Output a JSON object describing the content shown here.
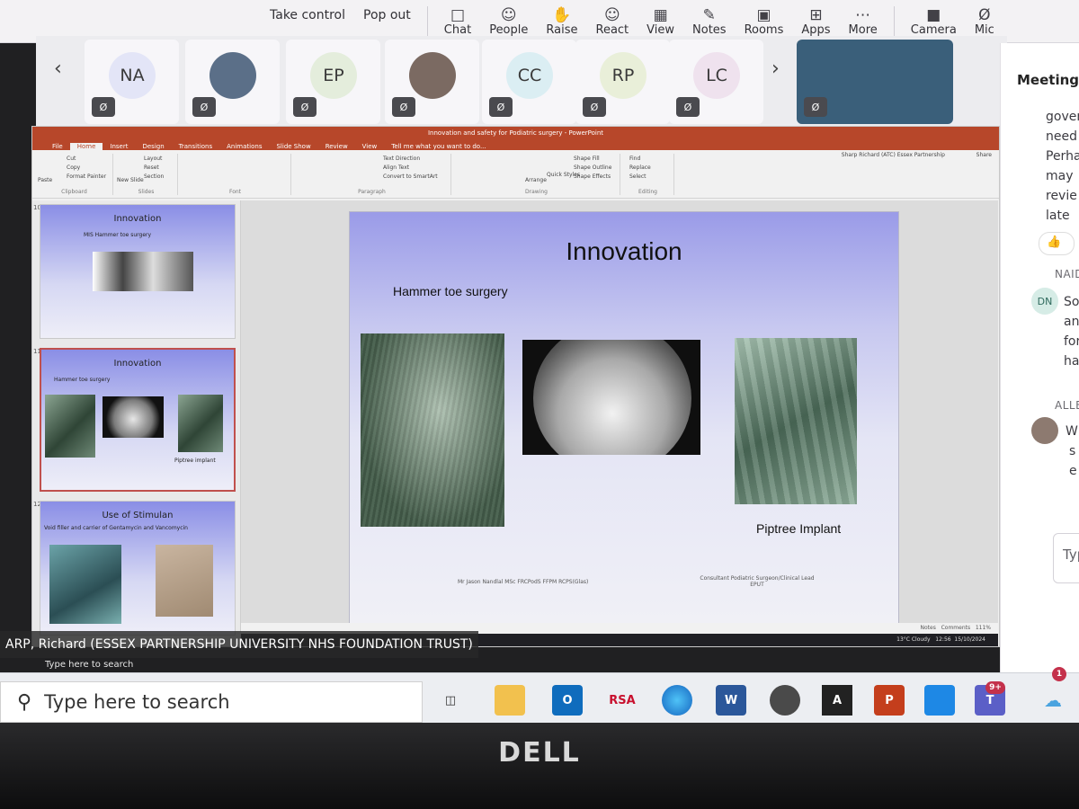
{
  "toolbar": {
    "take_control": "Take control",
    "pop_out": "Pop out",
    "chat": "Chat",
    "people": "People",
    "raise": "Raise",
    "react": "React",
    "view": "View",
    "notes": "Notes",
    "rooms": "Rooms",
    "apps": "Apps",
    "more": "More",
    "camera": "Camera",
    "mic": "Mic",
    "accent": "#5b5fc7"
  },
  "participants": [
    {
      "initials": "NA",
      "color": "#e3e5f7"
    },
    {
      "initials": "",
      "color": "#5b6f88"
    },
    {
      "initials": "EP",
      "color": "#e4eddc"
    },
    {
      "initials": "",
      "color": "#7b6a62"
    },
    {
      "initials": "CC",
      "color": "#dbeef3"
    },
    {
      "initials": "RP",
      "color": "#e9efd9"
    },
    {
      "initials": "LC",
      "color": "#efe2ee"
    }
  ],
  "meeting": {
    "title": "Meeting",
    "chat_fragments": [
      "gover",
      "need",
      "Perha",
      "may",
      "revie",
      "late"
    ],
    "sender1": "NAIDO",
    "avatar1": "DN",
    "msg1": [
      "Sor",
      "anc",
      "for",
      "ha"
    ],
    "sender2": "ALLE",
    "msg2": [
      "W",
      "s",
      "e"
    ],
    "type_placeholder": "Typ"
  },
  "ppt": {
    "window_title": "Innovation and safety for Podiatric surgery - PowerPoint",
    "tabs": [
      "File",
      "Home",
      "Insert",
      "Design",
      "Transitions",
      "Animations",
      "Slide Show",
      "Review",
      "View",
      "Tell me what you want to do..."
    ],
    "account": "Sharp Richard (ATC) Essex Partnership",
    "share": "Share",
    "ribbon": {
      "paste": "Paste",
      "cut": "Cut",
      "copy": "Copy",
      "format_painter": "Format Painter",
      "clipboard": "Clipboard",
      "new_slide": "New Slide",
      "layout": "Layout",
      "reset": "Reset",
      "section": "Section",
      "slides": "Slides",
      "font": "Font",
      "text_direction": "Text Direction",
      "align_text": "Align Text",
      "convert_smartart": "Convert to SmartArt",
      "paragraph": "Paragraph",
      "arrange": "Arrange",
      "quick_styles": "Quick Styles",
      "shape_fill": "Shape Fill",
      "shape_outline": "Shape Outline",
      "shape_effects": "Shape Effects",
      "drawing": "Drawing",
      "find": "Find",
      "replace": "Replace",
      "select": "Select",
      "editing": "Editing"
    },
    "thumbnails": [
      {
        "num": "10",
        "title": "Innovation",
        "sub": "MIS Hammer toe surgery"
      },
      {
        "num": "11",
        "title": "Innovation",
        "sub": "Hammer toe surgery",
        "caption": "Piptree implant"
      },
      {
        "num": "12",
        "title": "Use of Stimulan",
        "sub": "Void filler and carrier of Gentamycin and Vancomycin"
      }
    ],
    "slide": {
      "title": "Innovation",
      "subtitle": "Hammer toe surgery",
      "caption": "Piptree Implant",
      "author": "Mr Jason Nandlal MSc FRCPodS FFPM RCPS(Glas)",
      "role": "Consultant Podiatric Surgeon/Clinical Lead EPUT"
    },
    "status": {
      "notes": "Notes",
      "comments": "Comments",
      "zoom": "111%"
    },
    "remote_taskbar": {
      "weather": "13°C Cloudy",
      "time": "12:56",
      "date": "15/10/2024"
    }
  },
  "presenter": {
    "name": "ARP, Richard (ESSEX PARTNERSHIP UNIVERSITY NHS FOUNDATION TRUST)",
    "remote_search": "Type here to search"
  },
  "taskbar": {
    "search_placeholder": "Type here to search",
    "rsa": "RSA",
    "teams_badge": "9+",
    "weather_badge": "1"
  },
  "bezel": {
    "brand": "DELL"
  }
}
